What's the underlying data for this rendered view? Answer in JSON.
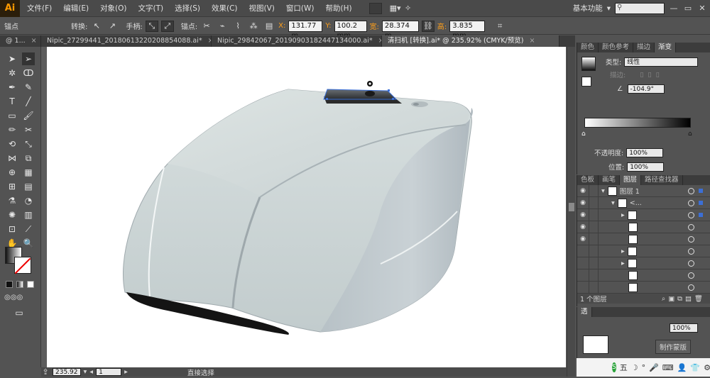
{
  "app": {
    "logo": "Ai"
  },
  "menu": [
    "文件(F)",
    "编辑(E)",
    "对象(O)",
    "文字(T)",
    "选择(S)",
    "效果(C)",
    "视图(V)",
    "窗口(W)",
    "帮助(H)"
  ],
  "workspace": {
    "label": "基本功能",
    "search_placeholder": ""
  },
  "control": {
    "anchor_label": "锚点",
    "convert_label": "转换:",
    "handle_label": "手柄:",
    "anchor2_label": "锚点:",
    "x_label": "X:",
    "x_value": "131.77 m",
    "y_label": "Y:",
    "y_value": "100.2 mm",
    "w_label": "宽:",
    "w_value": "28.374 m",
    "h_label": "高:",
    "h_value": "3.835 mm"
  },
  "tabs": [
    {
      "label": "@ 1...",
      "close": "×",
      "active": false
    },
    {
      "label": "Nipic_27299441_20180613220208854088.ai*",
      "close": "×",
      "active": false
    },
    {
      "label": "Nipic_29842067_20190903182447134000.ai*",
      "close": "×",
      "active": false
    },
    {
      "label": "清扫机 [转换].ai* @ 235.92% (CMYK/预览)",
      "close": "×",
      "active": true
    }
  ],
  "status": {
    "zoom": "235.92",
    "page": "1",
    "tool": "直接选择"
  },
  "gradient_panel": {
    "tabs": [
      "颜色",
      "颜色参考",
      "描边",
      "渐变"
    ],
    "active_tab": "渐变",
    "type_label": "类型:",
    "type_value": "线性",
    "stroke_label": "描边:",
    "angle_value": "-104.9°",
    "opacity_label": "不透明度:",
    "opacity_value": "100%",
    "location_label": "位置:",
    "location_value": "100%"
  },
  "layers_panel": {
    "tabs": [
      "色板",
      "画笔",
      "图层",
      "路径查找器"
    ],
    "active_tab": "图层",
    "layer_name": "图层 1",
    "sublayer_name": "<...",
    "footer_count": "1 个图层"
  },
  "lower_panel": {
    "label": "透",
    "opacity": "100%",
    "mask_label": "制作蒙版"
  },
  "taskbar": {
    "ime": "五",
    "items": [
      "☽",
      "°",
      "🎤",
      "⌨",
      "👤",
      "👕",
      "⚙"
    ]
  },
  "colors": {
    "accent_orange": "#ff9a00",
    "selection_blue": "#3b6fd6",
    "panel_bg": "#535353",
    "body_light": "#e0e7e7",
    "body_shadow": "#b8c2c8"
  }
}
